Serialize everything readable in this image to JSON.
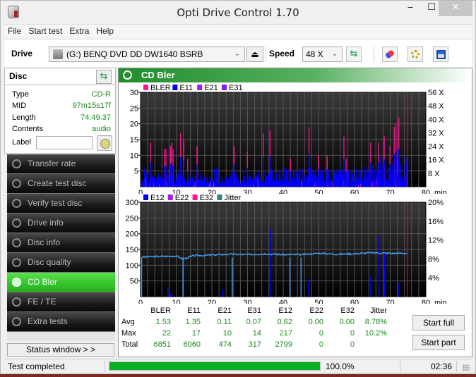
{
  "window": {
    "title": "Opti Drive Control 1.70",
    "minimize": "‒",
    "maximize": "☐",
    "close": "✕"
  },
  "menu": [
    "File",
    "Start test",
    "Extra",
    "Help"
  ],
  "toolbar": {
    "drive_label": "Drive",
    "drive_value": "(G:)   BENQ DVD DD DW1640 BSRB",
    "eject_icon": "⏏",
    "speed_label": "Speed",
    "speed_value": "48 X",
    "dropdown_icon": "⌄",
    "refresh_icon": "⇆",
    "erase_icon": "eraser-icon",
    "settings_icon": "gears-icon",
    "save_icon": "save-icon"
  },
  "disc": {
    "header": "Disc",
    "fields": [
      {
        "key": "Type",
        "value": "CD-R"
      },
      {
        "key": "MID",
        "value": "97m15s17f"
      },
      {
        "key": "Length",
        "value": "74:49.37"
      },
      {
        "key": "Contents",
        "value": "audio"
      }
    ],
    "label_key": "Label",
    "label_value": ""
  },
  "nav": [
    {
      "label": "Transfer rate",
      "active": false
    },
    {
      "label": "Create test disc",
      "active": false
    },
    {
      "label": "Verify test disc",
      "active": false
    },
    {
      "label": "Drive info",
      "active": false
    },
    {
      "label": "Disc info",
      "active": false
    },
    {
      "label": "Disc quality",
      "active": false
    },
    {
      "label": "CD Bler",
      "active": true
    },
    {
      "label": "FE / TE",
      "active": false
    },
    {
      "label": "Extra tests",
      "active": false
    }
  ],
  "status_window_button": "Status window > >",
  "panel": {
    "title": "CD Bler"
  },
  "chart_data": [
    {
      "type": "bar",
      "title": "CD Bler (BLER/E11/E21/E31)",
      "legend": [
        {
          "name": "BLER",
          "color": "#ff1493"
        },
        {
          "name": "E11",
          "color": "#0000ff"
        },
        {
          "name": "E21",
          "color": "#a020f0"
        },
        {
          "name": "E31",
          "color": "#8020ff"
        }
      ],
      "xlabel": "min",
      "xlim": [
        0,
        80
      ],
      "x_ticks": [
        0,
        10,
        20,
        30,
        40,
        50,
        60,
        70,
        80
      ],
      "ylim": [
        0,
        30
      ],
      "y_ticks": [
        5,
        10,
        15,
        20,
        25,
        30
      ],
      "y2_ticks": [
        "8 X",
        "16 X",
        "24 X",
        "32 X",
        "40 X",
        "48 X",
        "56 X"
      ],
      "y2lim": [
        0,
        56
      ],
      "end_marker_min": 74.8,
      "series": [
        {
          "name": "BLER_peaks",
          "x": [
            2.7,
            6.6,
            7.0,
            8.3,
            8.6,
            9.0,
            11.1,
            12.0,
            13.1,
            15.7,
            26.1,
            29.8,
            34.3,
            36.2,
            41.9,
            47.1,
            49.7,
            52.2,
            56.9,
            57.5,
            64.4,
            66.6,
            68.2,
            69.8,
            71.0,
            71.5,
            72.3
          ],
          "values": [
            14,
            12,
            12,
            13,
            14,
            12,
            17,
            15,
            9,
            13,
            13,
            11,
            17,
            18,
            9,
            19,
            10,
            10,
            16,
            9,
            14,
            14,
            16,
            13,
            19,
            20,
            22
          ]
        },
        {
          "name": "E11_typical",
          "x": [
            0,
            10,
            20,
            30,
            40,
            50,
            60,
            70,
            74.8
          ],
          "values": [
            3,
            3,
            3,
            3,
            4,
            4,
            4,
            5,
            8
          ]
        }
      ]
    },
    {
      "type": "bar",
      "title": "CD Bler (E12/E22/E32/Jitter)",
      "legend": [
        {
          "name": "E12",
          "color": "#0000ff"
        },
        {
          "name": "E22",
          "color": "#a020f0"
        },
        {
          "name": "E32",
          "color": "#ff1493"
        },
        {
          "name": "Jitter",
          "color": "#3a8080"
        }
      ],
      "xlabel": "min",
      "xlim": [
        0,
        80
      ],
      "x_ticks": [
        0,
        10,
        20,
        30,
        40,
        50,
        60,
        70,
        80
      ],
      "ylim": [
        0,
        300
      ],
      "y_ticks": [
        50,
        100,
        150,
        200,
        250,
        300
      ],
      "y2_ticks": [
        "4%",
        "8%",
        "12%",
        "16%",
        "20%"
      ],
      "y2lim": [
        0,
        20
      ],
      "end_marker_min": 74.8,
      "series": [
        {
          "name": "E12_peaks",
          "x": [
            7.5,
            8.2,
            8.6,
            22.9,
            36.2,
            47.0,
            64.4,
            66.7,
            68.2,
            72.3
          ],
          "values": [
            30,
            8,
            8,
            22,
            217,
            55,
            65,
            195,
            140,
            45
          ]
        },
        {
          "name": "Jitter_percent",
          "x": [
            0,
            5,
            10,
            12,
            15,
            20,
            25,
            30,
            35,
            40,
            45,
            50,
            55,
            60,
            65,
            70,
            74.8
          ],
          "values": [
            8.4,
            8.5,
            8.6,
            8.0,
            8.7,
            8.8,
            9.0,
            8.9,
            9.1,
            8.9,
            8.9,
            9.2,
            9.0,
            9.1,
            9.3,
            9.2,
            9.2
          ]
        }
      ]
    }
  ],
  "stats": {
    "columns": [
      "BLER",
      "E11",
      "E21",
      "E31",
      "E12",
      "E22",
      "E32",
      "Jitter"
    ],
    "rows": [
      {
        "label": "Avg",
        "values": [
          "1.53",
          "1.35",
          "0.11",
          "0.07",
          "0.62",
          "0.00",
          "0.00",
          "8.78%"
        ]
      },
      {
        "label": "Max",
        "values": [
          "22",
          "17",
          "10",
          "14",
          "217",
          "0",
          "0",
          "10.2%"
        ]
      },
      {
        "label": "Total",
        "values": [
          "6851",
          "6060",
          "474",
          "317",
          "2799",
          "0",
          "0",
          ""
        ]
      }
    ]
  },
  "buttons": {
    "start_full": "Start full",
    "start_part": "Start part"
  },
  "statusbar": {
    "text": "Test completed",
    "progress": 1.0,
    "progress_label": "100.0%",
    "time": "02:36"
  }
}
